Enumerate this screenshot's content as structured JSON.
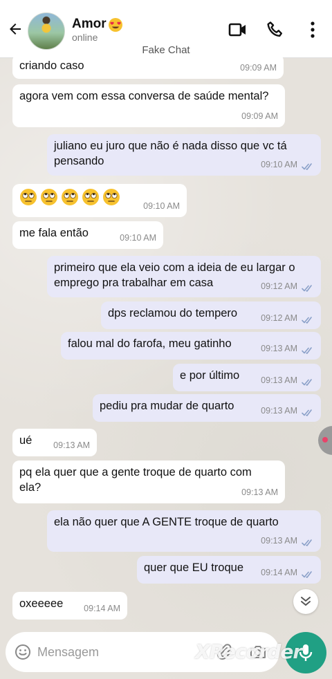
{
  "header": {
    "contact_name": "Amor",
    "contact_status": "online",
    "subtitle": "Fake Chat"
  },
  "messages": [
    {
      "dir": "in",
      "text": "criando caso",
      "time": "09:09 AM"
    },
    {
      "dir": "in",
      "text": "agora vem com essa conversa de saúde mental?",
      "time": "09:09 AM"
    },
    {
      "dir": "out",
      "text": "juliano eu juro que não é nada disso que vc tá pensando",
      "time": "09:10 AM"
    },
    {
      "dir": "in",
      "text": "",
      "emoji": "face-with-rolling-eyes x5",
      "time": "09:10 AM"
    },
    {
      "dir": "in",
      "text": "me fala então",
      "time": "09:10 AM"
    },
    {
      "dir": "out",
      "text": "primeiro que ela veio com a ideia de eu largar o emprego pra trabalhar em casa",
      "time": "09:12 AM"
    },
    {
      "dir": "out",
      "text": "dps reclamou do tempero",
      "time": "09:12 AM"
    },
    {
      "dir": "out",
      "text": "falou mal do farofa, meu gatinho",
      "time": "09:13 AM"
    },
    {
      "dir": "out",
      "text": "e por último",
      "time": "09:13 AM"
    },
    {
      "dir": "out",
      "text": "pediu pra mudar de quarto",
      "time": "09:13 AM"
    },
    {
      "dir": "in",
      "text": "ué",
      "time": "09:13 AM"
    },
    {
      "dir": "in",
      "text": "pq ela quer que a gente troque de quarto com ela?",
      "time": "09:13 AM"
    },
    {
      "dir": "out",
      "text": "ela não quer que A GENTE troque de quarto",
      "time": "09:13 AM"
    },
    {
      "dir": "out",
      "text": "quer que EU troque",
      "time": "09:14 AM"
    },
    {
      "dir": "in",
      "text": "oxeeeee",
      "time": "09:14 AM"
    }
  ],
  "composer": {
    "placeholder": "Mensagem"
  },
  "watermark": "XRecorder",
  "icons": {
    "back": "arrow-left-icon",
    "video": "video-call-icon",
    "call": "phone-icon",
    "menu": "more-vertical-icon",
    "emoji": "smiley-icon",
    "attach": "paperclip-icon",
    "camera": "camera-icon",
    "scroll_down": "double-chevron-down-icon",
    "send": "mic-icon"
  },
  "colors": {
    "outgoing_bubble": "#e8e8f8",
    "incoming_bubble": "#ffffff",
    "send_button": "#20a084",
    "tick_color": "#8aa0c8"
  }
}
